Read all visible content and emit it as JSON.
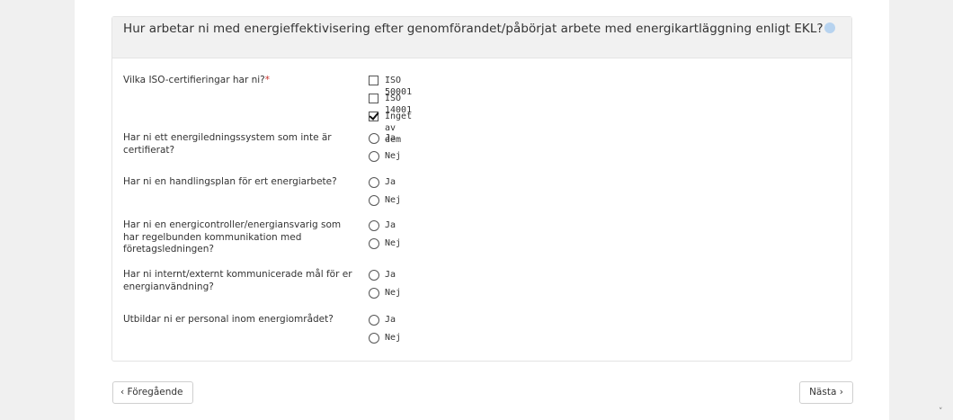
{
  "header": {
    "title": "Hur arbetar ni med energieffektivisering efter genomförandet/påbörjat arbete med energikartläggning enligt EKL?"
  },
  "questions": [
    {
      "label": "Vilka ISO-certifieringar har ni?",
      "required_mark": "*",
      "type": "checkbox",
      "options": [
        {
          "label": "ISO 50001",
          "checked": false
        },
        {
          "label": "ISO 14001",
          "checked": false
        },
        {
          "label": "Inget av dem",
          "checked": true
        }
      ]
    },
    {
      "label": "Har ni ett energiledningssystem som inte är certifierat?",
      "type": "radio",
      "options": [
        {
          "label": "Ja"
        },
        {
          "label": "Nej"
        }
      ]
    },
    {
      "label": "Har ni en handlingsplan för ert energiarbete?",
      "type": "radio",
      "options": [
        {
          "label": "Ja"
        },
        {
          "label": "Nej"
        }
      ]
    },
    {
      "label": "Har ni en energicontroller/energiansvarig som har regelbunden kommunikation med företagsledningen?",
      "type": "radio",
      "options": [
        {
          "label": "Ja"
        },
        {
          "label": "Nej"
        }
      ]
    },
    {
      "label": "Har ni internt/externt kommunicerade mål för er energianvändning?",
      "type": "radio",
      "options": [
        {
          "label": "Ja"
        },
        {
          "label": "Nej"
        }
      ]
    },
    {
      "label": "Utbildar ni er personal inom energiområdet?",
      "type": "radio",
      "options": [
        {
          "label": "Ja"
        },
        {
          "label": "Nej"
        }
      ]
    }
  ],
  "nav": {
    "prev_label": "‹ Föregående",
    "next_label": "Nästa ›"
  },
  "scrollbar": {
    "down_arrow": "˅"
  }
}
